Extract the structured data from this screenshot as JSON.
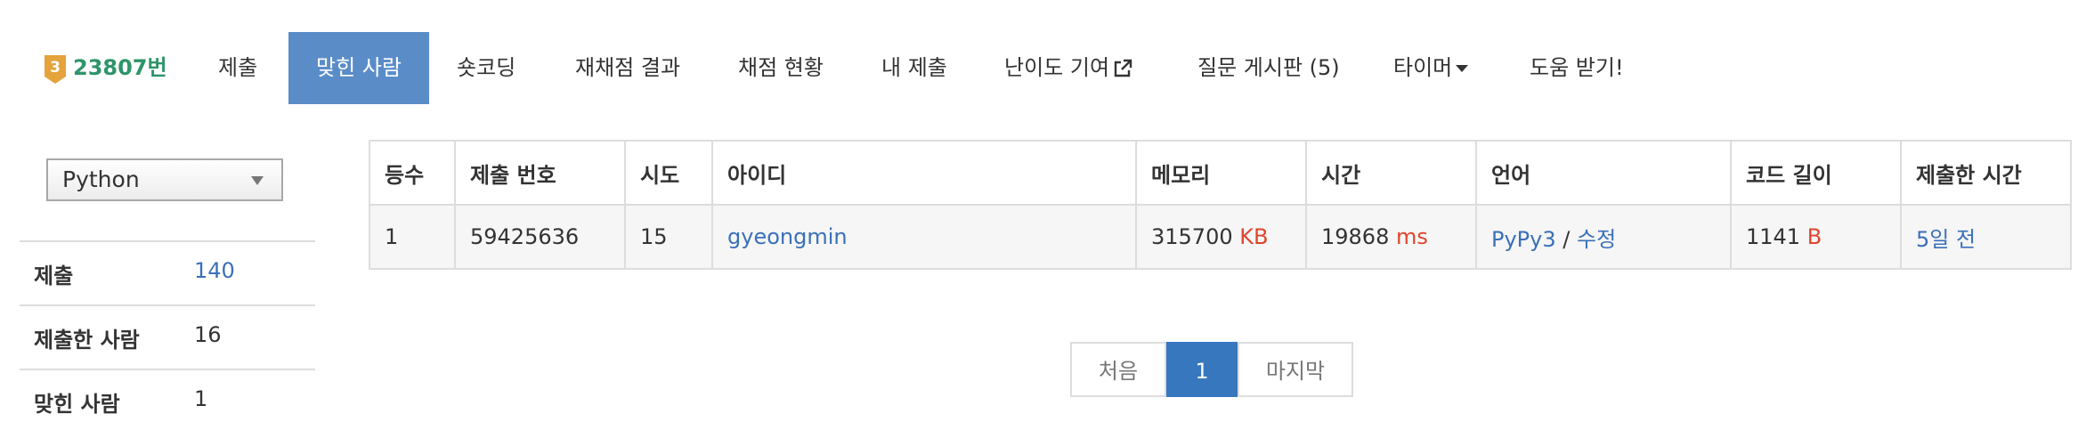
{
  "nav": {
    "tier": "3",
    "problem_id": "23807번",
    "items": [
      "제출",
      "맞힌 사람",
      "숏코딩",
      "재채점 결과",
      "채점 현황",
      "내 제출",
      "난이도 기여",
      "질문 게시판 (5)",
      "타이머",
      "도움 받기!"
    ],
    "active_index": 1
  },
  "filter": {
    "language": "Python"
  },
  "stats": [
    {
      "label": "제출",
      "value": "140"
    },
    {
      "label": "제출한 사람",
      "value": "16"
    },
    {
      "label": "맞힌 사람",
      "value": "1"
    }
  ],
  "table": {
    "headers": [
      "등수",
      "제출 번호",
      "시도",
      "아이디",
      "메모리",
      "시간",
      "언어",
      "코드 길이",
      "제출한 시간"
    ],
    "row": {
      "rank": "1",
      "submission_id": "59425636",
      "attempts": "15",
      "user": "gyeongmin",
      "memory": "315700",
      "memory_unit": "KB",
      "time": "19868",
      "time_unit": "ms",
      "language": "PyPy3",
      "separator": "/",
      "edit": "수정",
      "code_length": "1141",
      "code_unit": "B",
      "submitted": "5일 전"
    }
  },
  "pagination": {
    "first": "처음",
    "current": "1",
    "last": "마지막"
  },
  "colors": {
    "active_tab": "#5a8dc8",
    "link": "#3a70b8",
    "unit": "#e0442e",
    "tier_badge": "#e5a33b",
    "problem_id": "#2f9469"
  }
}
